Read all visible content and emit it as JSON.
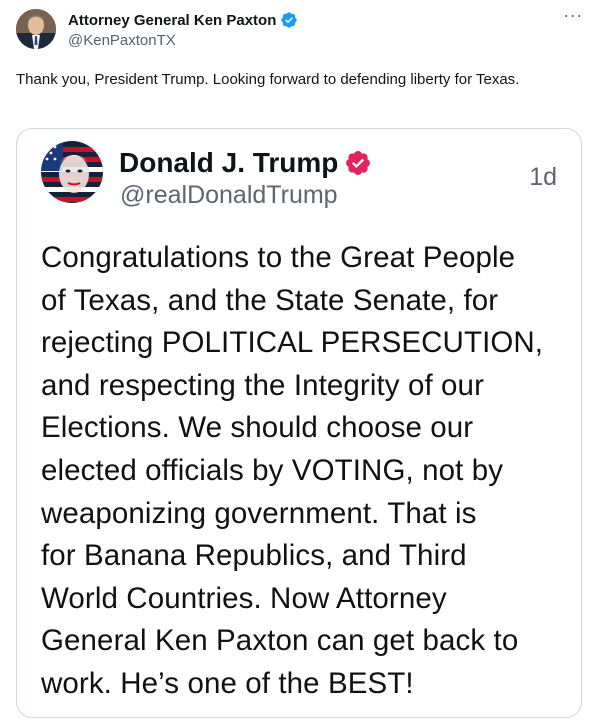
{
  "author": {
    "name": "Attorney General Ken Paxton",
    "handle": "@KenPaxtonTX",
    "verified_icon": "verified-badge-icon",
    "verified_color": "#1d9bf0"
  },
  "more_label": "···",
  "tweet": {
    "text": "Thank you, President Trump. Looking forward to defending liberty for Texas."
  },
  "quoted_post": {
    "name": "Donald J. Trump",
    "handle": "@realDonaldTrump",
    "time": "1d",
    "verified_color": "#e0245e",
    "body_lines": [
      "Congratulations to the Great People",
      "of Texas, and the State Senate, for",
      "rejecting POLITICAL PERSECUTION,",
      "and respecting the Integrity of our",
      "Elections. We should choose our",
      "elected officials by VOTING, not by",
      "weaponizing government. That is",
      "for Banana Republics, and Third",
      "World Countries. Now Attorney",
      "General Ken Paxton can get back to",
      "work. He’s one of the BEST!"
    ]
  }
}
